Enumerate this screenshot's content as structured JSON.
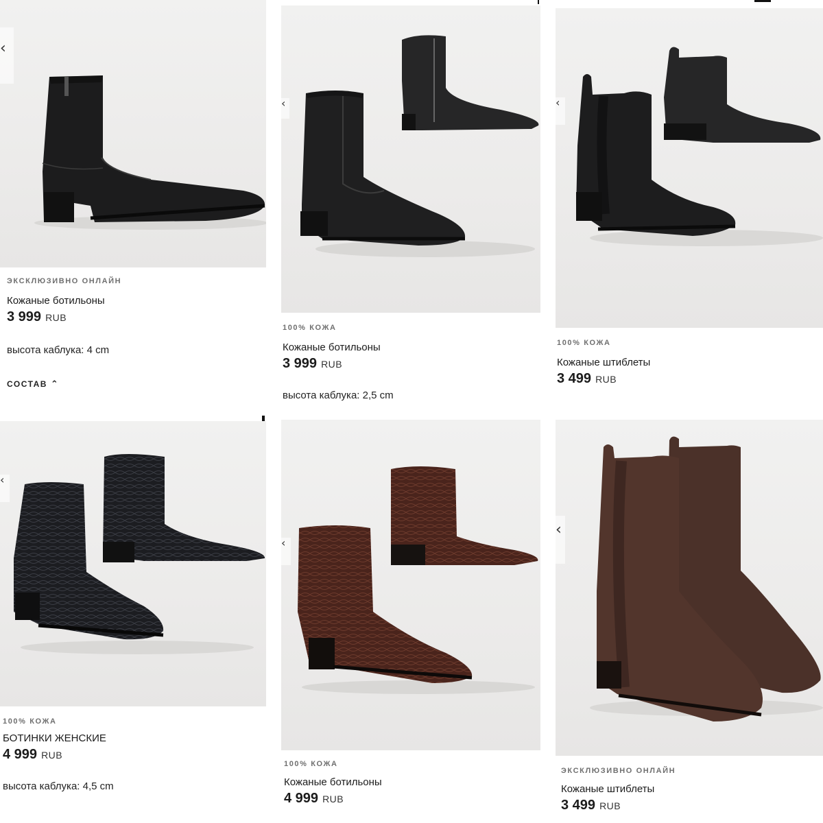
{
  "products": [
    {
      "badge": "ЭКСКЛЮЗИВНО ОНЛАЙН",
      "name": "Кожаные ботильоны",
      "price": "3 999",
      "currency": "RUB",
      "heel": "высота каблука: 4 cm",
      "composition": "СОСТАВ",
      "leather": "#1c1c1d"
    },
    {
      "badge": "100% КОЖА",
      "name": "Кожаные ботильоны",
      "price": "3 999",
      "currency": "RUB",
      "heel": "высота каблука: 2,5 cm",
      "leather": "#1f1f20"
    },
    {
      "badge": "100% КОЖА",
      "name": "Кожаные штиблеты",
      "price": "3 499",
      "currency": "RUB",
      "leather": "#1e1e1f"
    },
    {
      "badge": "100% КОЖА",
      "name": "БОТИНКИ ЖЕНСКИЕ",
      "price": "4 999",
      "currency": "RUB",
      "heel": "высота каблука: 4,5 cm",
      "leather": "#1b1c20"
    },
    {
      "badge": "100% КОЖА",
      "name": "Кожаные ботильоны",
      "price": "4 999",
      "currency": "RUB",
      "leather": "#4a241c"
    },
    {
      "badge": "ЭКСКЛЮЗИВНО ОНЛАЙН",
      "name": "Кожаные штиблеты",
      "price": "3 499",
      "currency": "RUB",
      "leather": "#4b3129"
    }
  ],
  "icons": {
    "prev": "chevron-left-icon",
    "expand": "chevron-up-icon"
  },
  "colors": {
    "background": "#ffffff",
    "text": "#1b1b1b",
    "badge": "#6f6f6f"
  }
}
